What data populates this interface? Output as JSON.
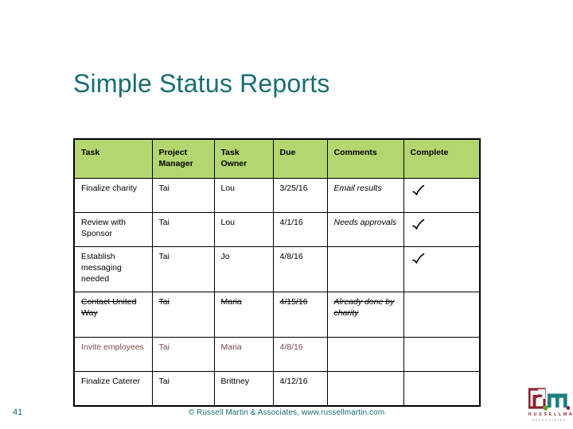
{
  "slide": {
    "title": "Simple Status Reports",
    "background_color": "#ffffff",
    "title_color": "#196e72"
  },
  "table": {
    "header_bg": "#b4d670",
    "border_color": "#000000",
    "columns": [
      {
        "key": "task",
        "label": "Task"
      },
      {
        "key": "project_manager",
        "label": "Project Manager"
      },
      {
        "key": "task_owner",
        "label": "Task Owner"
      },
      {
        "key": "due",
        "label": "Due"
      },
      {
        "key": "comments",
        "label": "Comments"
      },
      {
        "key": "complete",
        "label": "Complete"
      }
    ],
    "rows": [
      {
        "task": "Finalize charity",
        "project_manager": "Tai",
        "task_owner": "Lou",
        "due": "3/25/16",
        "comments": "Email results",
        "complete": "check",
        "strikethrough": false,
        "muted": false
      },
      {
        "task": "Review with Sponsor",
        "project_manager": "Tai",
        "task_owner": "Lou",
        "due": "4/1/16",
        "comments": "Needs approvals",
        "complete": "check",
        "strikethrough": false,
        "muted": false
      },
      {
        "task": "Establish messaging needed",
        "project_manager": "Tai",
        "task_owner": "Jo",
        "due": "4/8/16",
        "comments": "",
        "complete": "check",
        "strikethrough": false,
        "muted": false
      },
      {
        "task": "Contact United Way",
        "project_manager": "Tai",
        "task_owner": "Maria",
        "due": "4/15/16",
        "comments": "Already done by charity",
        "complete": "",
        "strikethrough": true,
        "muted": false
      },
      {
        "task": "Invite employees",
        "project_manager": "Tai",
        "task_owner": "Maria",
        "due": "4/8/16",
        "comments": "",
        "complete": "",
        "strikethrough": false,
        "muted": true,
        "muted_color": "#7c4b4b"
      },
      {
        "task": "Finalize Caterer",
        "project_manager": "Tai",
        "task_owner": "Brittney",
        "due": "4/12/16",
        "comments": "",
        "complete": "",
        "strikethrough": false,
        "muted": false
      }
    ]
  },
  "footer": {
    "page_number": "41",
    "copyright": "© Russell Martin & Associates, www.russellmartin.com",
    "text_color": "#196e72"
  },
  "logo": {
    "wordmark": "R U S S E L L   M A R T I N",
    "tagline": "& A S S O C I A T E S",
    "mark_red": "#8c2332",
    "mark_teal": "#1e7f82",
    "mark_green": "#6f9b2f"
  }
}
